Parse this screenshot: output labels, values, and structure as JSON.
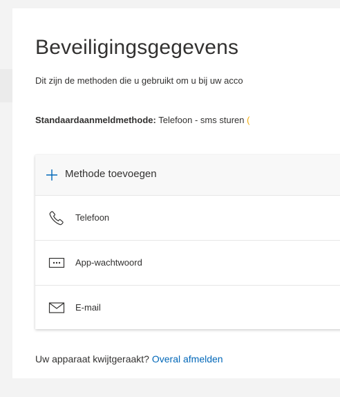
{
  "page": {
    "title": "Beveiligingsgegevens",
    "subtitle": "Dit zijn de methoden die u gebruikt om u bij uw acco"
  },
  "default_method": {
    "label": "Standaardaanmeldmethode:",
    "value": "Telefoon - sms sturen",
    "cut_fragment": "("
  },
  "methods_card": {
    "add_label": "Methode toevoegen",
    "items": [
      {
        "label": "Telefoon",
        "icon": "phone-icon"
      },
      {
        "label": "App-wachtwoord",
        "icon": "app-password-icon"
      },
      {
        "label": "E-mail",
        "icon": "mail-icon"
      }
    ]
  },
  "lost_device": {
    "text": "Uw apparaat kwijtgeraakt?",
    "link": "Overal afmelden"
  },
  "colors": {
    "accent": "#0067b8",
    "text": "#323130",
    "background": "#f3f3f3",
    "warning": "#f2a900"
  }
}
